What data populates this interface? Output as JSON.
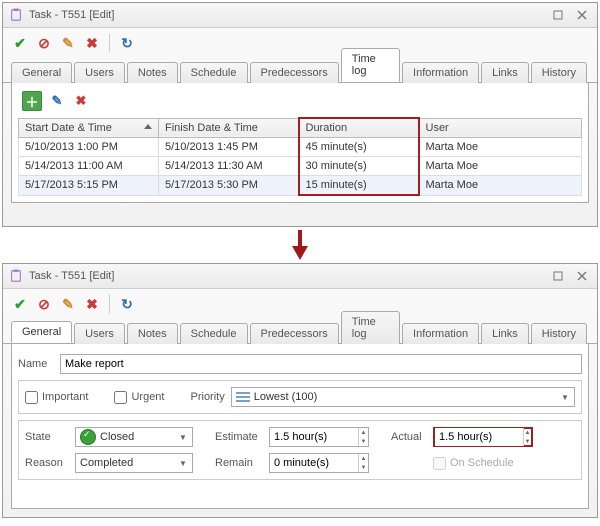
{
  "window_title": "Task - T551 [Edit]",
  "tabs": {
    "general": "General",
    "users": "Users",
    "notes": "Notes",
    "schedule": "Schedule",
    "predecessors": "Predecessors",
    "timelog": "Time log",
    "information": "Information",
    "links": "Links",
    "history": "History"
  },
  "timelog": {
    "columns": {
      "start": "Start Date & Time",
      "finish": "Finish Date & Time",
      "duration": "Duration",
      "user": "User"
    },
    "rows": [
      {
        "start": "5/10/2013 1:00 PM",
        "finish": "5/10/2013 1:45 PM",
        "duration": "45 minute(s)",
        "user": "Marta Moe"
      },
      {
        "start": "5/14/2013 11:00 AM",
        "finish": "5/14/2013 11:30 AM",
        "duration": "30 minute(s)",
        "user": "Marta Moe"
      },
      {
        "start": "5/17/2013 5:15 PM",
        "finish": "5/17/2013 5:30 PM",
        "duration": "15 minute(s)",
        "user": "Marta Moe"
      }
    ]
  },
  "general": {
    "name_label": "Name",
    "name_value": "Make report",
    "important_label": "Important",
    "urgent_label": "Urgent",
    "priority_label": "Priority",
    "priority_value": "Lowest (100)",
    "state_label": "State",
    "state_value": "Closed",
    "reason_label": "Reason",
    "reason_value": "Completed",
    "estimate_label": "Estimate",
    "estimate_value": "1.5 hour(s)",
    "remain_label": "Remain",
    "remain_value": "0 minute(s)",
    "actual_label": "Actual",
    "actual_value": "1.5 hour(s)",
    "onschedule_label": "On Schedule"
  }
}
